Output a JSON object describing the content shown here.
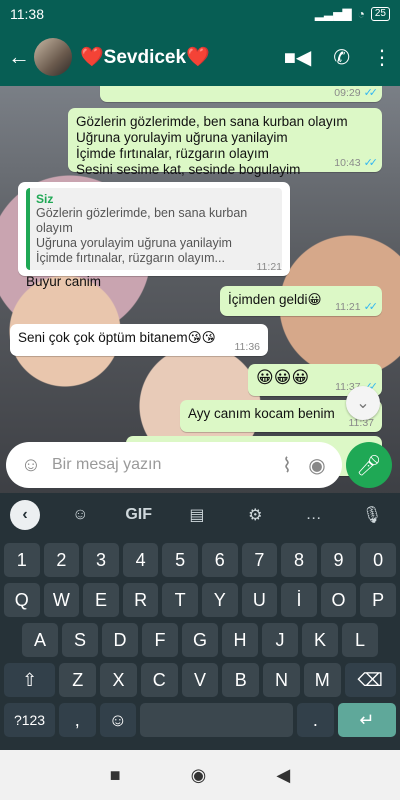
{
  "status": {
    "time": "11:38",
    "battery": "25"
  },
  "header": {
    "contact_name": "❤️Sevdicek❤️"
  },
  "messages": [
    {
      "dir": "out",
      "text": "",
      "time": "09:29"
    },
    {
      "dir": "out",
      "lines": [
        "Gözlerin gözlerimde, ben sana kurban olayım",
        "Uğruna yorulayim uğruna yanilayim",
        "İçimde fırtınalar, rüzgarın olayım",
        "Sesini sesime kat, sesinde bogulayim"
      ],
      "time": "10:43"
    },
    {
      "dir": "in",
      "quote": {
        "author": "Siz",
        "lines": [
          "Gözlerin gözlerimde, ben sana kurban olayım",
          "Uğruna yorulayim uğruna yanilayim",
          "İçimde fırtınalar, rüzgarın olayım..."
        ]
      },
      "text": "Buyur canim",
      "time": "11:21"
    },
    {
      "dir": "out",
      "text": "İçimden geldi😀",
      "time": "11:21"
    },
    {
      "dir": "in",
      "text": "Seni çok çok öptüm bitanem😘😘",
      "time": "11:36"
    },
    {
      "dir": "out",
      "text": "😀😀😀",
      "time": "11:37"
    },
    {
      "dir": "out",
      "text": "Ayy canım kocam benim",
      "time": "11:37"
    }
  ],
  "input": {
    "placeholder": "Bir mesaj yazın"
  },
  "keyboard": {
    "toolbar": [
      "GIF"
    ],
    "rows": [
      [
        "1",
        "2",
        "3",
        "4",
        "5",
        "6",
        "7",
        "8",
        "9",
        "0"
      ],
      [
        "Q",
        "W",
        "E",
        "R",
        "T",
        "Y",
        "U",
        "İ",
        "O",
        "P"
      ],
      [
        "A",
        "S",
        "D",
        "F",
        "G",
        "H",
        "J",
        "K",
        "L"
      ],
      [
        "Z",
        "X",
        "C",
        "V",
        "B",
        "N",
        "M"
      ],
      [
        "?123",
        ","
      ]
    ],
    "period": "."
  }
}
